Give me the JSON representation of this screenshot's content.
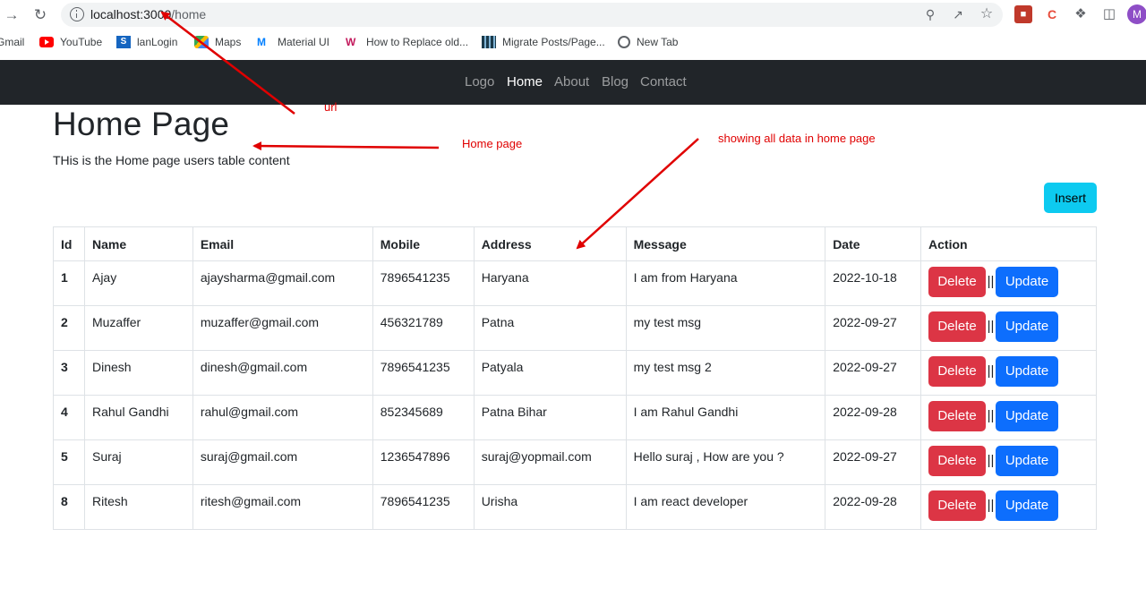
{
  "browser": {
    "url_host": "localhost:3000",
    "url_path": "/home",
    "avatar_letter": "M",
    "icons": [
      "forward-icon",
      "reload-icon",
      "info-icon",
      "zoom-icon",
      "share-icon",
      "star-icon",
      "extension-icon",
      "puzzle-icon",
      "sidepanel-icon"
    ]
  },
  "bookmarks": [
    {
      "label": "Gmail"
    },
    {
      "label": "YouTube"
    },
    {
      "label": "lanLogin",
      "badge": "S"
    },
    {
      "label": "Maps"
    },
    {
      "label": "Material UI",
      "badge": "M"
    },
    {
      "label": "How to Replace old...",
      "badge": "W"
    },
    {
      "label": "Migrate Posts/Page..."
    },
    {
      "label": "New Tab"
    }
  ],
  "navbar": {
    "links": [
      "Logo",
      "Home",
      "About",
      "Blog",
      "Contact"
    ],
    "active": "Home"
  },
  "page": {
    "title": "Home Page",
    "description": "THis is the Home page users table content",
    "insert_label": "Insert"
  },
  "table": {
    "headers": [
      "Id",
      "Name",
      "Email",
      "Mobile",
      "Address",
      "Message",
      "Date",
      "Action"
    ],
    "rows": [
      {
        "id": "1",
        "name": "Ajay",
        "email": "ajaysharma@gmail.com",
        "mobile": "7896541235",
        "address": "Haryana",
        "message": "I am from Haryana",
        "date": "2022-10-18"
      },
      {
        "id": "2",
        "name": "Muzaffer",
        "email": "muzaffer@gmail.com",
        "mobile": "456321789",
        "address": "Patna",
        "message": "my test msg",
        "date": "2022-09-27"
      },
      {
        "id": "3",
        "name": "Dinesh",
        "email": "dinesh@gmail.com",
        "mobile": "7896541235",
        "address": "Patyala",
        "message": "my test msg 2",
        "date": "2022-09-27"
      },
      {
        "id": "4",
        "name": "Rahul Gandhi",
        "email": "rahul@gmail.com",
        "mobile": "852345689",
        "address": "Patna Bihar",
        "message": "I am Rahul Gandhi",
        "date": "2022-09-28"
      },
      {
        "id": "5",
        "name": "Suraj",
        "email": "suraj@gmail.com",
        "mobile": "1236547896",
        "address": "suraj@yopmail.com",
        "message": "Hello suraj , How are you ?",
        "date": "2022-09-27"
      },
      {
        "id": "8",
        "name": "Ritesh",
        "email": "ritesh@gmail.com",
        "mobile": "7896541235",
        "address": "Urisha",
        "message": "I am react developer",
        "date": "2022-09-28"
      }
    ],
    "delete_label": "Delete",
    "update_label": "Update",
    "separator": "||"
  },
  "annotations": {
    "url": "url",
    "home": "Home page",
    "data": "showing all data in home page"
  },
  "colors": {
    "navbar_bg": "#212529",
    "insert_btn": "#0dcaf0",
    "delete_btn": "#dc3545",
    "update_btn": "#0d6efd",
    "annotation": "#e00000"
  }
}
